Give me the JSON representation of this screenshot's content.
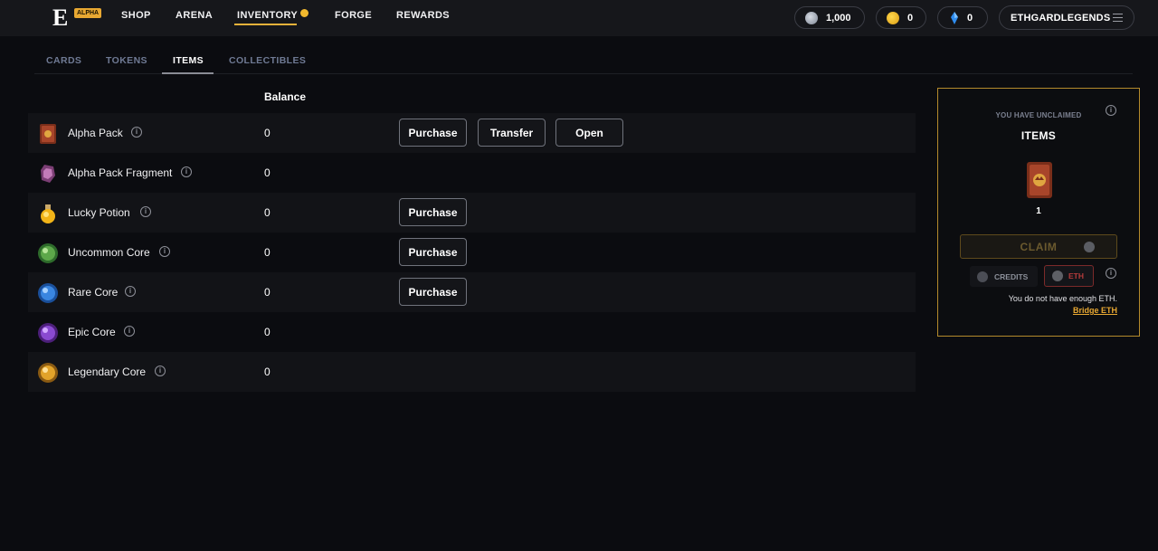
{
  "nav": {
    "logo_letter": "E",
    "badge": "ALPHA",
    "items": [
      "SHOP",
      "ARENA",
      "INVENTORY",
      "FORGE",
      "REWARDS"
    ],
    "active": "INVENTORY"
  },
  "wallet": {
    "credits": "1,000",
    "gold": "0",
    "gems": "0",
    "username": "ETHGARDLEGENDS"
  },
  "tabs": [
    "CARDS",
    "TOKENS",
    "ITEMS",
    "COLLECTIBLES"
  ],
  "active_tab": "ITEMS",
  "table": {
    "balance_header": "Balance",
    "rows": [
      {
        "name": "Alpha Pack",
        "balance": "0",
        "actions": [
          "Purchase",
          "Transfer",
          "Open"
        ]
      },
      {
        "name": "Alpha Pack Fragment",
        "balance": "0",
        "actions": []
      },
      {
        "name": "Lucky Potion",
        "balance": "0",
        "actions": [
          "Purchase"
        ]
      },
      {
        "name": "Uncommon Core",
        "balance": "0",
        "actions": [
          "Purchase"
        ]
      },
      {
        "name": "Rare Core",
        "balance": "0",
        "actions": [
          "Purchase"
        ]
      },
      {
        "name": "Epic Core",
        "balance": "0",
        "actions": []
      },
      {
        "name": "Legendary Core",
        "balance": "0",
        "actions": []
      }
    ]
  },
  "claim": {
    "subtitle": "YOU HAVE UNCLAIMED",
    "title": "ITEMS",
    "count": "1",
    "button": "CLAIM",
    "pay_credits": "CREDITS",
    "pay_eth": "ETH",
    "warning": "You do not have enough ETH.",
    "link": "Bridge ETH"
  },
  "colors": {
    "accent": "#e6b23a",
    "panel_border": "#b48a2c",
    "eth_warning": "#b53b3b"
  }
}
